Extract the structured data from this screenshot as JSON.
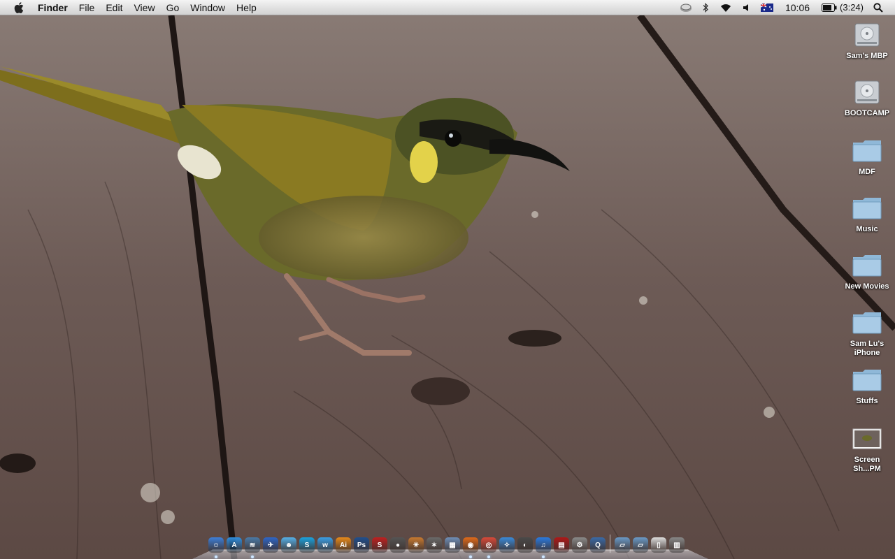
{
  "menubar": {
    "app_name": "Finder",
    "menus": [
      "File",
      "Edit",
      "View",
      "Go",
      "Window",
      "Help"
    ],
    "clock": "10:06",
    "battery_time": "(3:24)",
    "status_icons": [
      "time-machine-icon",
      "bluetooth-icon",
      "wifi-icon",
      "volume-icon",
      "australia-flag-icon",
      "battery-icon",
      "spotlight-search-icon"
    ]
  },
  "desktop_icons": [
    {
      "label": "Sam's MBP",
      "icon": "hard-drive-icon"
    },
    {
      "label": "BOOTCAMP",
      "icon": "hard-drive-icon"
    },
    {
      "label": "MDF",
      "icon": "folder-icon"
    },
    {
      "label": "Music",
      "icon": "folder-icon"
    },
    {
      "label": "New Movies",
      "icon": "folder-icon"
    },
    {
      "label": "Sam Lu's iPhone",
      "icon": "folder-icon"
    },
    {
      "label": "Stuffs",
      "icon": "folder-icon"
    },
    {
      "label": "Screen Sh...PM",
      "icon": "screenshot-thumbnail-icon"
    }
  ],
  "dock": {
    "apps": [
      {
        "name": "finder-icon",
        "glyph": "☺",
        "color": "#3d7fd9",
        "running": true
      },
      {
        "name": "app-store-icon",
        "glyph": "A",
        "color": "#2f8fe0",
        "running": false
      },
      {
        "name": "network-utility-icon",
        "glyph": "≋",
        "color": "#4a7aa8",
        "running": true
      },
      {
        "name": "mail-bird-icon",
        "glyph": "✈",
        "color": "#2e66c8",
        "running": false
      },
      {
        "name": "messenger-icon",
        "glyph": "☻",
        "color": "#55b0e8",
        "running": false
      },
      {
        "name": "skype-icon",
        "glyph": "S",
        "color": "#1aa3e0",
        "running": false
      },
      {
        "name": "wave-app-icon",
        "glyph": "w",
        "color": "#3aa0e8",
        "running": false
      },
      {
        "name": "illustrator-icon",
        "glyph": "Ai",
        "color": "#e88a1a",
        "running": false
      },
      {
        "name": "photoshop-icon",
        "glyph": "Ps",
        "color": "#1f4f8f",
        "running": false
      },
      {
        "name": "sbx-icon",
        "glyph": "S",
        "color": "#c02020",
        "running": false
      },
      {
        "name": "dvd-player-icon",
        "glyph": "●",
        "color": "#555555",
        "running": false
      },
      {
        "name": "iphoto-icon",
        "glyph": "☀",
        "color": "#c87a30",
        "running": false
      },
      {
        "name": "settings-wrench-icon",
        "glyph": "✶",
        "color": "#6a6a6a",
        "running": false
      },
      {
        "name": "preview-icon",
        "glyph": "▦",
        "color": "#6f8fb8",
        "running": false
      },
      {
        "name": "firefox-icon",
        "glyph": "◉",
        "color": "#e06a1a",
        "running": true
      },
      {
        "name": "chrome-icon",
        "glyph": "◎",
        "color": "#d94a3a",
        "running": true
      },
      {
        "name": "safari-icon",
        "glyph": "✧",
        "color": "#3a8ad9",
        "running": false
      },
      {
        "name": "facetime-icon",
        "glyph": "◐",
        "color": "#4a4a4a",
        "running": false
      },
      {
        "name": "itunes-icon",
        "glyph": "♫",
        "color": "#2a7ae0",
        "running": true
      },
      {
        "name": "photo-booth-icon",
        "glyph": "▤",
        "color": "#b01818",
        "running": false
      },
      {
        "name": "system-preferences-icon",
        "glyph": "⚙",
        "color": "#8a8a8a",
        "running": false
      },
      {
        "name": "quicktime-icon",
        "glyph": "Q",
        "color": "#3a6aa8",
        "running": false
      }
    ],
    "stacks": [
      {
        "name": "applications-stack-icon",
        "glyph": "▱",
        "color": "#6a9ac8"
      },
      {
        "name": "documents-stack-icon",
        "glyph": "▱",
        "color": "#6a9ac8"
      },
      {
        "name": "downloads-stack-icon",
        "glyph": "▯",
        "color": "#dddddd"
      },
      {
        "name": "trash-icon",
        "glyph": "▥",
        "color": "#888888"
      }
    ]
  }
}
